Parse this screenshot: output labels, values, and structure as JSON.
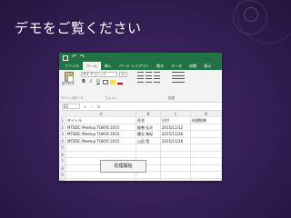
{
  "slide": {
    "title": "デモをご覧ください"
  },
  "excel": {
    "qat": {
      "undo": "↶",
      "redo": "↷"
    },
    "tabs": [
      "ファイル",
      "ホーム",
      "挿入",
      "ページ レイアウト",
      "数式",
      "データ",
      "校閲",
      "表示"
    ],
    "ribbon": {
      "paste_label": "貼り付け",
      "font_name": "ＭＳ Ｐゴシック",
      "font_size": "11",
      "group_labels": {
        "clipboard": "クリップボード",
        "font": "フォント",
        "alignment": "配置"
      },
      "bold": "B",
      "italic": "I",
      "underline": "U"
    },
    "formula_bar": {
      "cell_ref": "E5",
      "cancel": "×",
      "enter": "✓",
      "fx": "fx"
    },
    "columns": [
      "A",
      "B",
      "C",
      "D"
    ],
    "rows": [
      {
        "num": "1",
        "cells": [
          "タイトル",
          "氏名",
          "日付",
          "処理結果"
        ]
      },
      {
        "num": "2",
        "cells": [
          "MTDDC Meetup TOKYO 2015",
          "能勢 弘光",
          "2015/11/12",
          ""
        ]
      },
      {
        "num": "3",
        "cells": [
          "MTDDC Meetup TOKYO 2015",
          "櫻谷 勇紀",
          "2015/11/28",
          ""
        ]
      },
      {
        "num": "4",
        "cells": [
          "MTDDC Meetup TOKYO 2015",
          "山田 賢",
          "2015/11/28",
          ""
        ]
      },
      {
        "num": "5",
        "cells": [
          "",
          "",
          "",
          ""
        ]
      },
      {
        "num": "6",
        "cells": [
          "",
          "",
          "",
          ""
        ]
      },
      {
        "num": "7",
        "cells": [
          "",
          "",
          "",
          ""
        ]
      },
      {
        "num": "8",
        "cells": [
          "",
          "",
          "",
          ""
        ]
      },
      {
        "num": "9",
        "cells": [
          "",
          "",
          "",
          ""
        ]
      },
      {
        "num": "10",
        "cells": [
          "",
          "",
          "",
          ""
        ]
      }
    ],
    "process_button": "処理開始"
  }
}
